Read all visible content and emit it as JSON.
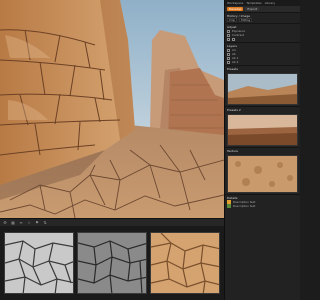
{
  "panel": {
    "top_items": [
      "Workspace",
      "Templates",
      "Library"
    ],
    "tabs": [
      "Develop",
      "Export"
    ],
    "history_title": "History / Image",
    "history_rows": [
      "Crop",
      "Editing"
    ],
    "adjust_title": "Adjust",
    "adjust_values": [
      "Exposure",
      "Contrast"
    ],
    "layers_title": "Layers",
    "layer_rows": [
      "All",
      "Ab",
      "Ab 1",
      "Ab 2"
    ],
    "preset1_title": "Presets",
    "preset2_title": "Presets 2",
    "preset3_title": "Texture",
    "bottom_title": "Details",
    "info_rows": [
      "Description text",
      "Description text"
    ]
  },
  "strip": {
    "thumbs": [
      "",
      "",
      ""
    ]
  },
  "colors": {
    "accent": "#e07a1f",
    "panel_bg": "#222222",
    "rock_light": "#d9a874",
    "rock_dark": "#8a5a34",
    "sky": "#b9c9d6"
  }
}
